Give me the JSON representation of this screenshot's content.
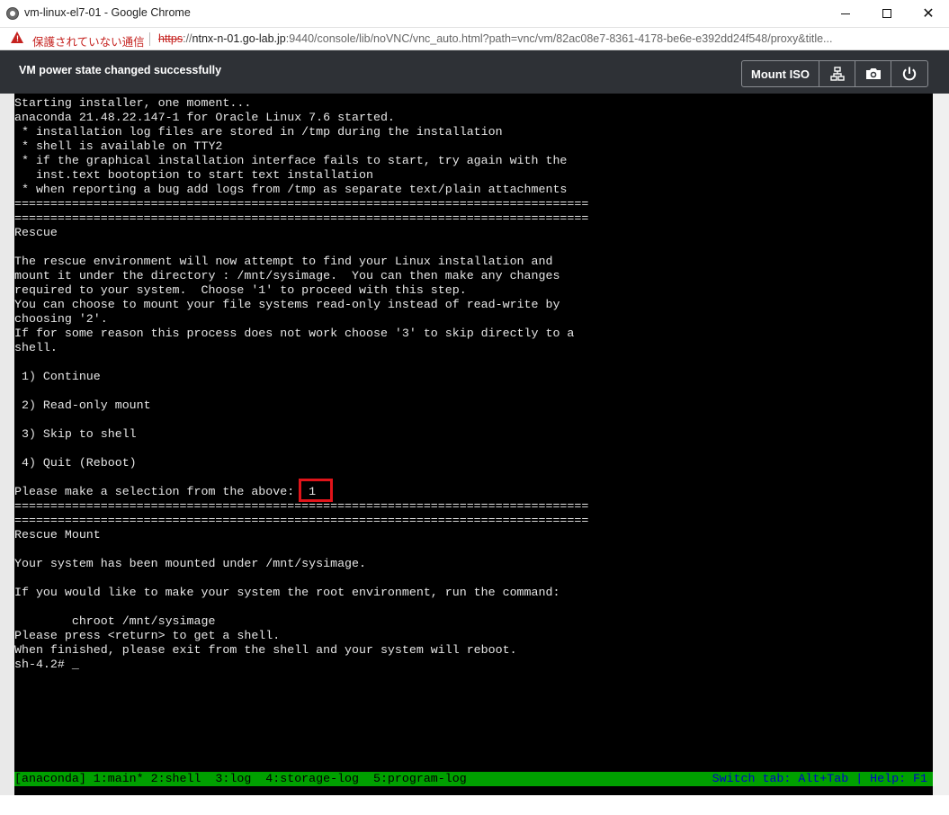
{
  "window": {
    "title": "vm-linux-el7-01 - Google Chrome",
    "buttons": {
      "minimize": "",
      "maximize": "",
      "close": "✕"
    }
  },
  "address_bar": {
    "security_label": "保護されていない通信",
    "url_scheme": "https",
    "url_sep": "://",
    "url_host": "ntnx-n-01.go-lab.jp",
    "url_rest": ":9440/console/lib/noVNC/vnc_auto.html?path=vnc/vm/82ac08e7-8361-4178-be6e-e392dd24f548/proxy&title..."
  },
  "vnc_toolbar": {
    "status": "VM power state changed successfully",
    "mount_iso_label": "Mount ISO",
    "icons": [
      "network-icon",
      "camera-icon",
      "power-icon"
    ]
  },
  "terminal": {
    "text": "Starting installer, one moment...\nanaconda 21.48.22.147-1 for Oracle Linux 7.6 started.\n * installation log files are stored in /tmp during the installation\n * shell is available on TTY2\n * if the graphical installation interface fails to start, try again with the\n   inst.text bootoption to start text installation\n * when reporting a bug add logs from /tmp as separate text/plain attachments\n================================================================================\n================================================================================\nRescue\n\nThe rescue environment will now attempt to find your Linux installation and\nmount it under the directory : /mnt/sysimage.  You can then make any changes\nrequired to your system.  Choose '1' to proceed with this step.\nYou can choose to mount your file systems read-only instead of read-write by\nchoosing '2'.\nIf for some reason this process does not work choose '3' to skip directly to a\nshell.\n\n 1) Continue\n\n 2) Read-only mount\n\n 3) Skip to shell\n\n 4) Quit (Reboot)\n\nPlease make a selection from the above:  1\n================================================================================\n================================================================================\nRescue Mount\n\nYour system has been mounted under /mnt/sysimage.\n\nIf you would like to make your system the root environment, run the command:\n\n        chroot /mnt/sysimage\nPlease press <return> to get a shell.\nWhen finished, please exit from the shell and your system will reboot.\nsh-4.2# _",
    "selection_value": "1",
    "status_left": "[anaconda] 1:main* 2:shell  3:log  4:storage-log  5:program-log",
    "status_right": "Switch tab: Alt+Tab | Help: F1"
  },
  "colors": {
    "terminal_bg": "#000000",
    "terminal_fg": "#e6e6e6",
    "status_bar_bg": "#00a000",
    "highlight": "#e0141a",
    "toolbar_bg": "#2e3136",
    "insecure": "#c5221f"
  }
}
